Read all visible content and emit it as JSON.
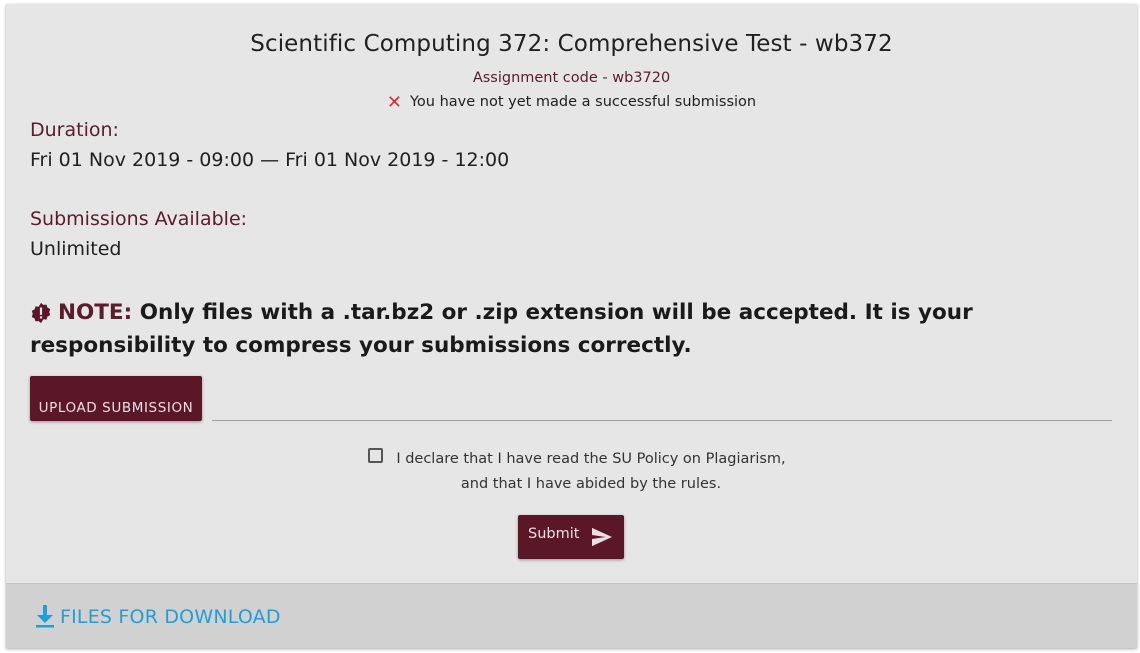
{
  "assignment": {
    "title": "Scientific Computing 372: Comprehensive Test - wb372",
    "code_line": "Assignment code - wb3720",
    "status_text": "You have not yet made a successful submission",
    "status_icon": "close-x-icon",
    "status_color": "#d32f2f"
  },
  "duration": {
    "label": "Duration:",
    "value": "Fri 01 Nov 2019 - 09:00 — Fri 01 Nov 2019 - 12:00"
  },
  "submissions": {
    "label": "Submissions Available:",
    "value": "Unlimited"
  },
  "note": {
    "icon": "alert-badge-icon",
    "label": "NOTE:",
    "text": "Only files with a .tar.bz2 or .zip extension will be accepted. It is your responsibility to compress your submissions correctly."
  },
  "upload": {
    "button_label": "UPLOAD SUBMISSION"
  },
  "declaration": {
    "line1": "I declare that I have read the SU Policy on Plagiarism,",
    "line2": "and that I have abided by the rules.",
    "checked": false
  },
  "submit": {
    "label": "Submit",
    "icon": "send-icon"
  },
  "footer": {
    "download_label": "FILES FOR DOWNLOAD",
    "download_icon": "download-icon"
  },
  "colors": {
    "accent": "#5b1628",
    "link": "#1e9fd6",
    "card_bg": "#e6e6e6",
    "footer_bg": "#d1d1d1"
  }
}
